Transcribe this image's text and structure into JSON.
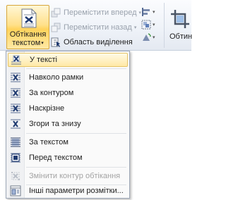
{
  "ribbon": {
    "wrap_text_button": {
      "line1": "Обтікання",
      "line2": "текстом",
      "caret": "▾",
      "icon": "wrap-text-icon"
    },
    "bring_forward": {
      "label": "Перемістити вперед",
      "caret": "▾",
      "icon": "bring-forward-icon"
    },
    "send_backward": {
      "label": "Перемістити назад",
      "caret": "▾",
      "icon": "send-backward-icon"
    },
    "selection_pane": {
      "label": "Область виділення",
      "icon": "selection-pane-icon"
    },
    "right_group_label": "Обтин",
    "caret": "▾"
  },
  "menu": {
    "items": [
      {
        "label": "У тексті",
        "icon": "wrap-inline-icon",
        "enabled": true,
        "highlighted": true
      },
      {
        "label": "Навколо рамки",
        "icon": "wrap-square-icon",
        "enabled": true
      },
      {
        "label": "За контуром",
        "icon": "wrap-tight-icon",
        "enabled": true
      },
      {
        "label": "Наскрізне",
        "icon": "wrap-through-icon",
        "enabled": true
      },
      {
        "label": "Згори та знизу",
        "icon": "wrap-top-bottom-icon",
        "enabled": true
      },
      {
        "label": "За текстом",
        "icon": "behind-text-icon",
        "enabled": true
      },
      {
        "label": "Перед текстом",
        "icon": "in-front-of-text-icon",
        "enabled": true
      },
      {
        "label": "Змінити контур обтікання",
        "icon": "edit-wrap-points-icon",
        "enabled": false
      },
      {
        "label": "Інші параметри розмітки...",
        "icon": "more-layout-options-icon",
        "enabled": true
      }
    ]
  },
  "colors": {
    "accent_highlight": "#ffe9a6",
    "menu_border": "#9da7b7",
    "disabled_text": "#a3a3a3"
  }
}
